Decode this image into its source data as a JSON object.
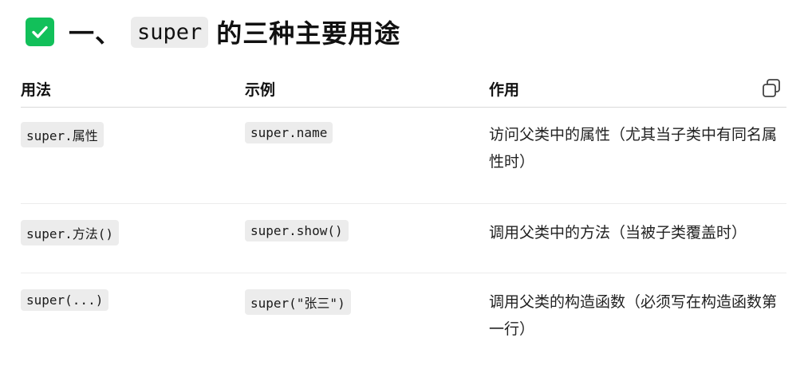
{
  "heading": {
    "prefix": "一、",
    "code": "super",
    "suffix": "的三种主要用途",
    "badge_color": "#12c05a"
  },
  "table": {
    "headers": [
      "用法",
      "示例",
      "作用"
    ],
    "rows": [
      {
        "usage": "super.属性",
        "example": "super.name",
        "purpose": "访问父类中的属性（尤其当子类中有同名属性时）"
      },
      {
        "usage": "super.方法()",
        "example": "super.show()",
        "purpose": "调用父类中的方法（当被子类覆盖时）"
      },
      {
        "usage": "super(...)",
        "example": "super(\"张三\")",
        "purpose": "调用父类的构造函数（必须写在构造函数第一行）"
      }
    ]
  },
  "icons": {
    "heading_icon": "checkmark-icon",
    "copy_icon": "copy-icon"
  }
}
